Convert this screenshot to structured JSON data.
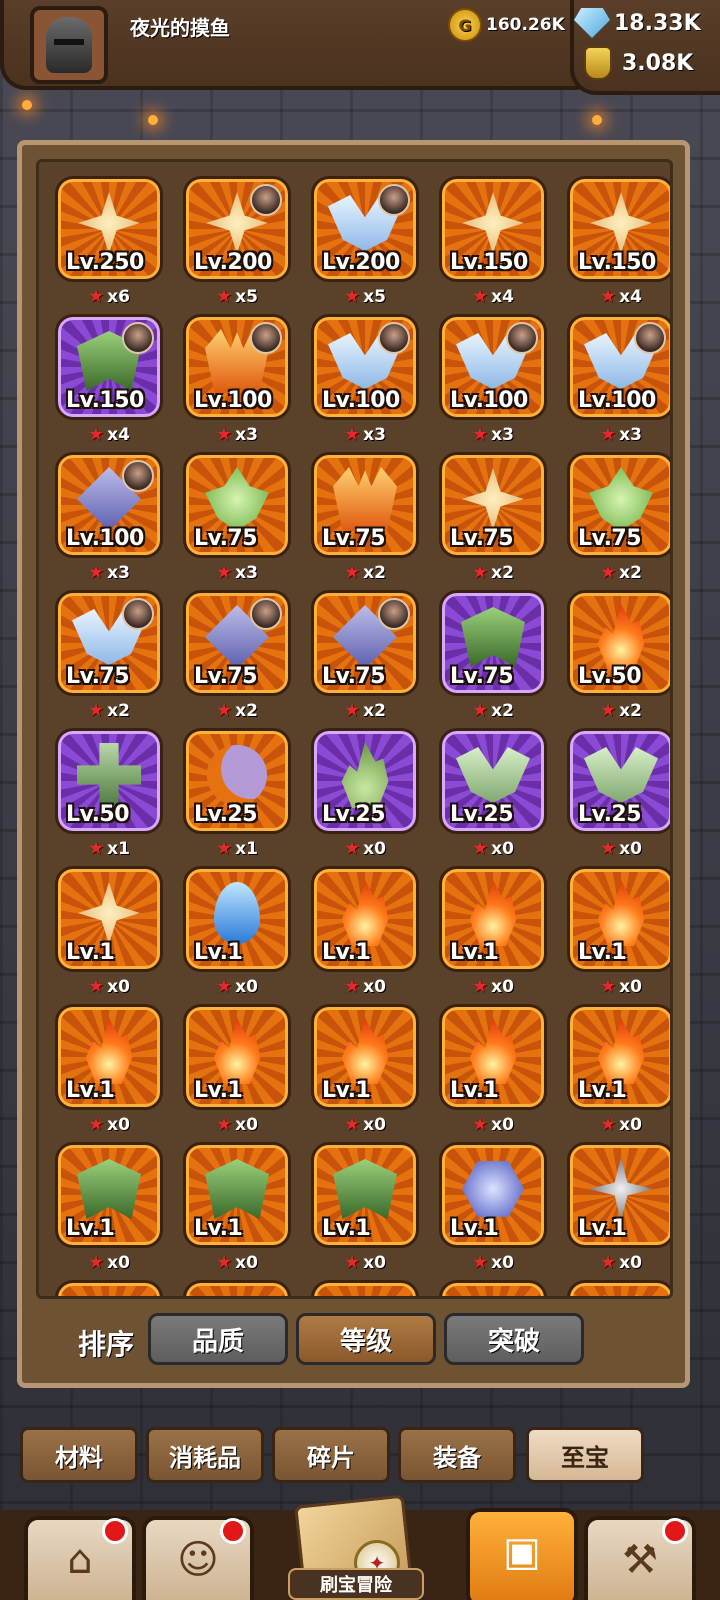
{
  "header": {
    "username": "夜光的摸鱼",
    "coins": "160.26K",
    "gems": "18.33K",
    "potions": "3.08K",
    "icons": {
      "avatar": "knight-helmet-icon",
      "coins": "gold-coin-icon",
      "gems": "blue-gem-icon",
      "potions": "potion-bottle-icon"
    }
  },
  "items": [
    {
      "level": "Lv.250",
      "count": "x6",
      "emblem": "shield",
      "color": "orange",
      "hero": false
    },
    {
      "level": "Lv.200",
      "count": "x5",
      "emblem": "shield",
      "color": "orange",
      "hero": true
    },
    {
      "level": "Lv.200",
      "count": "x5",
      "emblem": "wing",
      "color": "orange",
      "hero": true
    },
    {
      "level": "Lv.150",
      "count": "x4",
      "emblem": "shield",
      "color": "orange",
      "hero": false
    },
    {
      "level": "Lv.150",
      "count": "x4",
      "emblem": "shield",
      "color": "orange",
      "hero": false
    },
    {
      "level": "Lv.150",
      "count": "x4",
      "emblem": "mask",
      "color": "purple",
      "hero": true
    },
    {
      "level": "Lv.100",
      "count": "x3",
      "emblem": "crown",
      "color": "orange",
      "hero": true
    },
    {
      "level": "Lv.100",
      "count": "x3",
      "emblem": "wing",
      "color": "orange",
      "hero": true
    },
    {
      "level": "Lv.100",
      "count": "x3",
      "emblem": "wing",
      "color": "orange",
      "hero": true
    },
    {
      "level": "Lv.100",
      "count": "x3",
      "emblem": "wing",
      "color": "orange",
      "hero": true
    },
    {
      "level": "Lv.100",
      "count": "x3",
      "emblem": "diamond",
      "color": "orange",
      "hero": true
    },
    {
      "level": "Lv.75",
      "count": "x3",
      "emblem": "leaf",
      "color": "orange",
      "hero": false
    },
    {
      "level": "Lv.75",
      "count": "x2",
      "emblem": "crown",
      "color": "orange",
      "hero": false
    },
    {
      "level": "Lv.75",
      "count": "x2",
      "emblem": "shield",
      "color": "orange",
      "hero": false
    },
    {
      "level": "Lv.75",
      "count": "x2",
      "emblem": "leaf",
      "color": "orange",
      "hero": false
    },
    {
      "level": "Lv.75",
      "count": "x2",
      "emblem": "wing",
      "color": "orange",
      "hero": true
    },
    {
      "level": "Lv.75",
      "count": "x2",
      "emblem": "diamond",
      "color": "orange",
      "hero": true
    },
    {
      "level": "Lv.75",
      "count": "x2",
      "emblem": "diamond",
      "color": "orange",
      "hero": true
    },
    {
      "level": "Lv.75",
      "count": "x2",
      "emblem": "mask",
      "color": "purple",
      "hero": false
    },
    {
      "level": "Lv.50",
      "count": "x2",
      "emblem": "flame",
      "color": "orange",
      "hero": false
    },
    {
      "level": "Lv.50",
      "count": "x1",
      "emblem": "cross",
      "color": "purple",
      "hero": false
    },
    {
      "level": "Lv.25",
      "count": "x1",
      "emblem": "moon",
      "color": "orange",
      "hero": false
    },
    {
      "level": "Lv.25",
      "count": "x0",
      "emblem": "green-flame",
      "color": "purple",
      "hero": false
    },
    {
      "level": "Lv.25",
      "count": "x0",
      "emblem": "wing-green",
      "color": "purple",
      "hero": false
    },
    {
      "level": "Lv.25",
      "count": "x0",
      "emblem": "wing-green",
      "color": "purple",
      "hero": false
    },
    {
      "level": "Lv.1",
      "count": "x0",
      "emblem": "shield",
      "color": "orange",
      "hero": false
    },
    {
      "level": "Lv.1",
      "count": "x0",
      "emblem": "drop",
      "color": "orange",
      "hero": false
    },
    {
      "level": "Lv.1",
      "count": "x0",
      "emblem": "flame",
      "color": "orange",
      "hero": false
    },
    {
      "level": "Lv.1",
      "count": "x0",
      "emblem": "flame",
      "color": "orange",
      "hero": false
    },
    {
      "level": "Lv.1",
      "count": "x0",
      "emblem": "flame",
      "color": "orange",
      "hero": false
    },
    {
      "level": "Lv.1",
      "count": "x0",
      "emblem": "flame",
      "color": "orange",
      "hero": false
    },
    {
      "level": "Lv.1",
      "count": "x0",
      "emblem": "flame",
      "color": "orange",
      "hero": false
    },
    {
      "level": "Lv.1",
      "count": "x0",
      "emblem": "flame",
      "color": "orange",
      "hero": false
    },
    {
      "level": "Lv.1",
      "count": "x0",
      "emblem": "flame",
      "color": "orange",
      "hero": false
    },
    {
      "level": "Lv.1",
      "count": "x0",
      "emblem": "flame",
      "color": "orange",
      "hero": false
    },
    {
      "level": "Lv.1",
      "count": "x0",
      "emblem": "mask",
      "color": "orange",
      "hero": false
    },
    {
      "level": "Lv.1",
      "count": "x0",
      "emblem": "mask",
      "color": "orange",
      "hero": false
    },
    {
      "level": "Lv.1",
      "count": "x0",
      "emblem": "mask",
      "color": "orange",
      "hero": false
    },
    {
      "level": "Lv.1",
      "count": "x0",
      "emblem": "hex",
      "color": "orange",
      "hero": false
    },
    {
      "level": "Lv.1",
      "count": "x0",
      "emblem": "star",
      "color": "orange",
      "hero": false
    },
    {
      "level": "",
      "count": "",
      "emblem": "star",
      "color": "orange",
      "hero": false
    },
    {
      "level": "",
      "count": "",
      "emblem": "star",
      "color": "orange",
      "hero": false
    },
    {
      "level": "",
      "count": "",
      "emblem": "star",
      "color": "orange",
      "hero": false
    },
    {
      "level": "",
      "count": "",
      "emblem": "wing",
      "color": "orange",
      "hero": false
    },
    {
      "level": "",
      "count": "",
      "emblem": "crown",
      "color": "orange",
      "hero": false
    }
  ],
  "sort": {
    "label": "排序",
    "buttons": [
      {
        "label": "品质",
        "active": false
      },
      {
        "label": "等级",
        "active": true
      },
      {
        "label": "突破",
        "active": false
      }
    ]
  },
  "categories": [
    {
      "label": "材料",
      "active": false
    },
    {
      "label": "消耗品",
      "active": false
    },
    {
      "label": "碎片",
      "active": false
    },
    {
      "label": "装备",
      "active": false
    },
    {
      "label": "至宝",
      "active": true
    }
  ],
  "nav": {
    "center_label": "刷宝冒险",
    "buttons": [
      {
        "name": "shop",
        "icon": "shop-icon",
        "badge": true,
        "active": false
      },
      {
        "name": "hero",
        "icon": "hero-portrait-icon",
        "badge": true,
        "active": false
      },
      {
        "name": "bag",
        "icon": "backpack-icon",
        "badge": false,
        "active": true
      },
      {
        "name": "forge",
        "icon": "hammer-icon",
        "badge": true,
        "active": false
      }
    ]
  }
}
